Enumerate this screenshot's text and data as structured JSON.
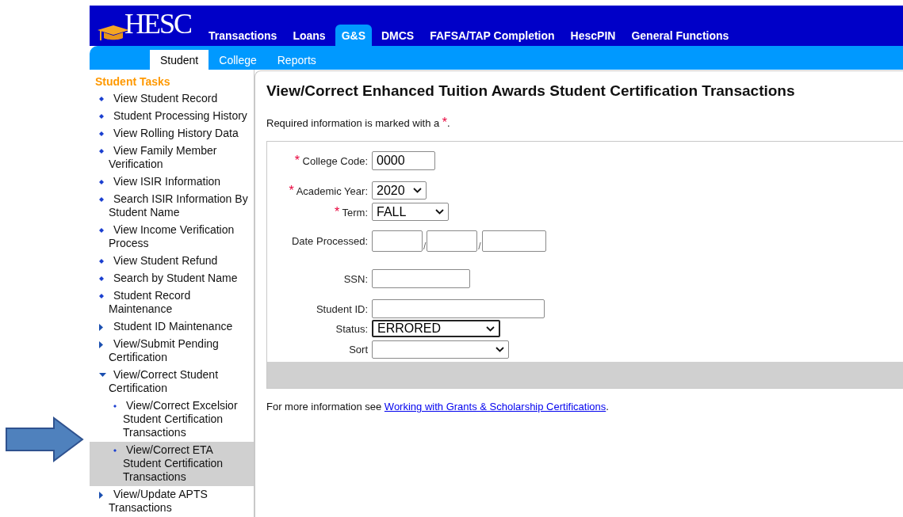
{
  "header": {
    "logo": "HESC",
    "nav": [
      {
        "label": "Transactions",
        "selected": false
      },
      {
        "label": "Loans",
        "selected": false
      },
      {
        "label": "G&S",
        "selected": true
      },
      {
        "label": "DMCS",
        "selected": false
      },
      {
        "label": "FAFSA/TAP Completion",
        "selected": false
      },
      {
        "label": "HescPIN",
        "selected": false
      },
      {
        "label": "General Functions",
        "selected": false
      }
    ],
    "subnav": [
      {
        "label": "Student",
        "selected": true
      },
      {
        "label": "College",
        "selected": false
      },
      {
        "label": "Reports",
        "selected": false
      }
    ]
  },
  "sidebar": {
    "title": "Student Tasks",
    "items": [
      {
        "label": "View Student Record",
        "kind": "task"
      },
      {
        "label": "Student Processing History",
        "kind": "task"
      },
      {
        "label": "View Rolling History Data",
        "kind": "task"
      },
      {
        "label": "View Family Member Verification",
        "kind": "task"
      },
      {
        "label": "View ISIR Information",
        "kind": "task"
      },
      {
        "label": "Search ISIR Information By Student Name",
        "kind": "task"
      },
      {
        "label": "View Income Verification Process",
        "kind": "task"
      },
      {
        "label": "View Student Refund",
        "kind": "task"
      },
      {
        "label": "Search by Student Name",
        "kind": "task"
      },
      {
        "label": "Student Record Maintenance",
        "kind": "task"
      },
      {
        "label": "Student ID Maintenance",
        "kind": "group",
        "expanded": false
      },
      {
        "label": "View/Submit Pending Certification",
        "kind": "group",
        "expanded": false
      },
      {
        "label": "View/Correct Student Certification",
        "kind": "group",
        "expanded": true,
        "children": [
          {
            "label": "View/Correct Excelsior Student Certification Transactions",
            "selected": false
          },
          {
            "label": "View/Correct ETA Student Certification Transactions",
            "selected": true
          }
        ]
      },
      {
        "label": "View/Update APTS Transactions",
        "kind": "group",
        "expanded": false
      }
    ]
  },
  "main": {
    "title": "View/Correct Enhanced Tuition Awards Student Certification Transactions",
    "required_note": {
      "text": "Required information is marked with a",
      "mark": "*",
      "end": "."
    },
    "fields": [
      {
        "label": "College Code:",
        "kind": "text",
        "required": true,
        "focused": false,
        "value": "0000"
      },
      {
        "label": "Academic Year:",
        "kind": "select",
        "required": true,
        "focused": false,
        "value": "2020"
      },
      {
        "label": "Term:",
        "kind": "select",
        "required": true,
        "focused": false,
        "value": "FALL"
      },
      {
        "label": "Date Processed:",
        "kind": "date",
        "required": false,
        "focused": false,
        "separators": [
          "/",
          "/"
        ]
      },
      {
        "label": "SSN:",
        "kind": "text",
        "required": false,
        "focused": false
      },
      {
        "label": "Student ID:",
        "kind": "text",
        "required": false,
        "focused": false
      },
      {
        "label": "Status:",
        "kind": "select",
        "required": false,
        "focused": true,
        "value": "ERRORED"
      },
      {
        "label": "Sort",
        "kind": "select",
        "required": false,
        "focused": false
      }
    ],
    "more_info": {
      "text": "For more information see",
      "link": "Working with Grants & Scholarship Certifications",
      "end": "."
    }
  }
}
